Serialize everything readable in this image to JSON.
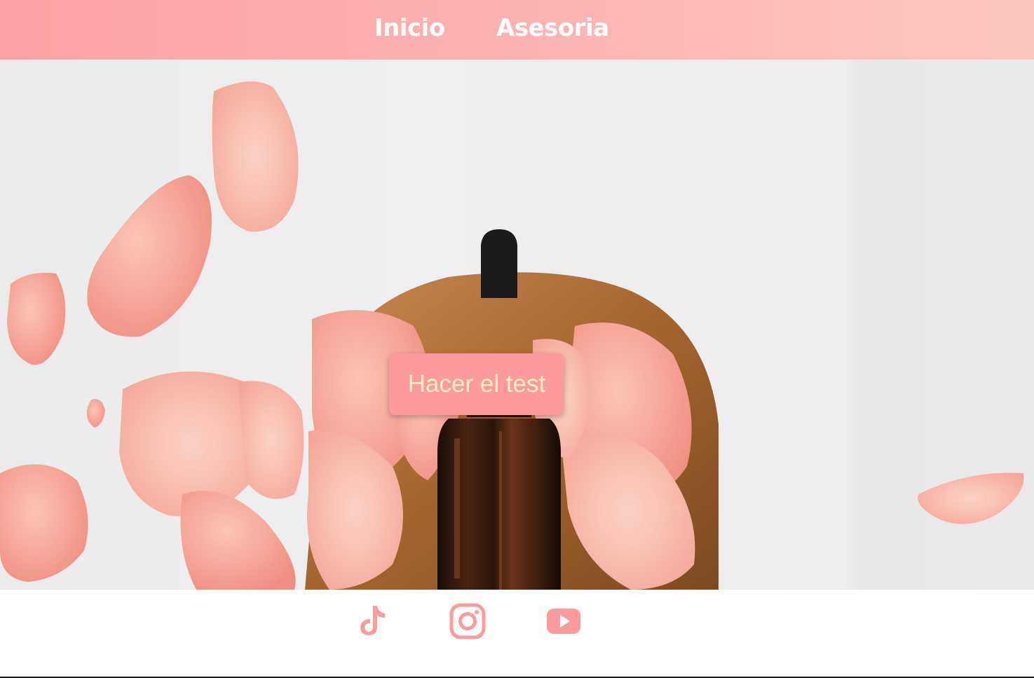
{
  "nav": {
    "items": [
      {
        "label": "Inicio"
      },
      {
        "label": "Asesoria"
      }
    ]
  },
  "hero": {
    "cta_label": "Hacer el test"
  },
  "footer": {
    "social": [
      {
        "icon": "tiktok-icon"
      },
      {
        "icon": "instagram-icon"
      },
      {
        "icon": "youtube-icon"
      }
    ]
  },
  "colors": {
    "accent": "#fb9b9d",
    "cta_text": "#fdf0c6",
    "nav_gradient_start": "#fda2a6",
    "nav_gradient_end": "#fdc7c1"
  }
}
